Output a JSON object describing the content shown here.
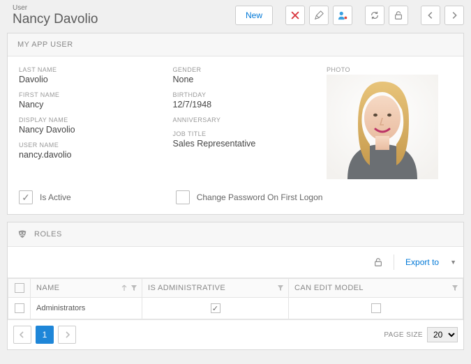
{
  "header": {
    "overline": "User",
    "title": "Nancy Davolio",
    "new_label": "New"
  },
  "user_card": {
    "title": "MY APP USER",
    "labels": {
      "last_name": "LAST NAME",
      "first_name": "FIRST NAME",
      "display_name": "DISPLAY NAME",
      "user_name": "USER NAME",
      "gender": "GENDER",
      "birthday": "BIRTHDAY",
      "anniversary": "ANNIVERSARY",
      "job_title": "JOB TITLE",
      "photo": "PHOTO",
      "is_active": "Is Active",
      "change_pw": "Change Password On First Logon"
    },
    "values": {
      "last_name": "Davolio",
      "first_name": "Nancy",
      "display_name": "Nancy Davolio",
      "user_name": "nancy.davolio",
      "gender": "None",
      "birthday": "12/7/1948",
      "anniversary": "",
      "job_title": "Sales Representative"
    },
    "checks": {
      "is_active": true,
      "change_pw": false
    }
  },
  "roles_card": {
    "title": "ROLES",
    "export_label": "Export to",
    "columns": {
      "name": "NAME",
      "is_admin": "IS ADMINISTRATIVE",
      "can_edit": "CAN EDIT MODEL"
    },
    "rows": [
      {
        "name": "Administrators",
        "is_admin": true,
        "can_edit": false
      }
    ],
    "pager": {
      "current": "1",
      "page_size_label": "PAGE SIZE",
      "page_size_value": "20"
    }
  }
}
